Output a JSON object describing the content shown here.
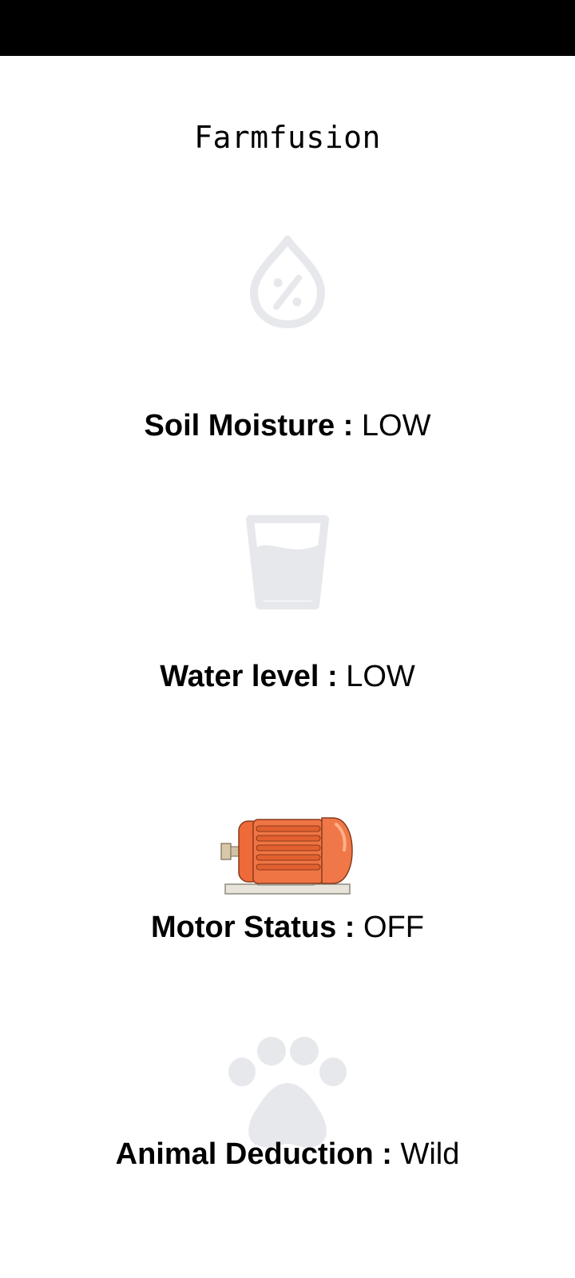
{
  "app": {
    "title": "Farmfusion"
  },
  "colors": {
    "status_bar": "#000000",
    "icon_gray": "#e7e8ec",
    "motor_orange": "#ee6a38",
    "text": "#000000"
  },
  "cards": [
    {
      "icon": "humidity-drop-icon",
      "label": "Soil Moisture : ",
      "value": " LOW"
    },
    {
      "icon": "water-glass-icon",
      "label": "Water level : ",
      "value": "LOW"
    },
    {
      "icon": "electric-motor-icon",
      "label": "Motor Status : ",
      "value": "OFF"
    },
    {
      "icon": "paw-icon",
      "label": "Animal Deduction : ",
      "value": "Wild"
    }
  ]
}
